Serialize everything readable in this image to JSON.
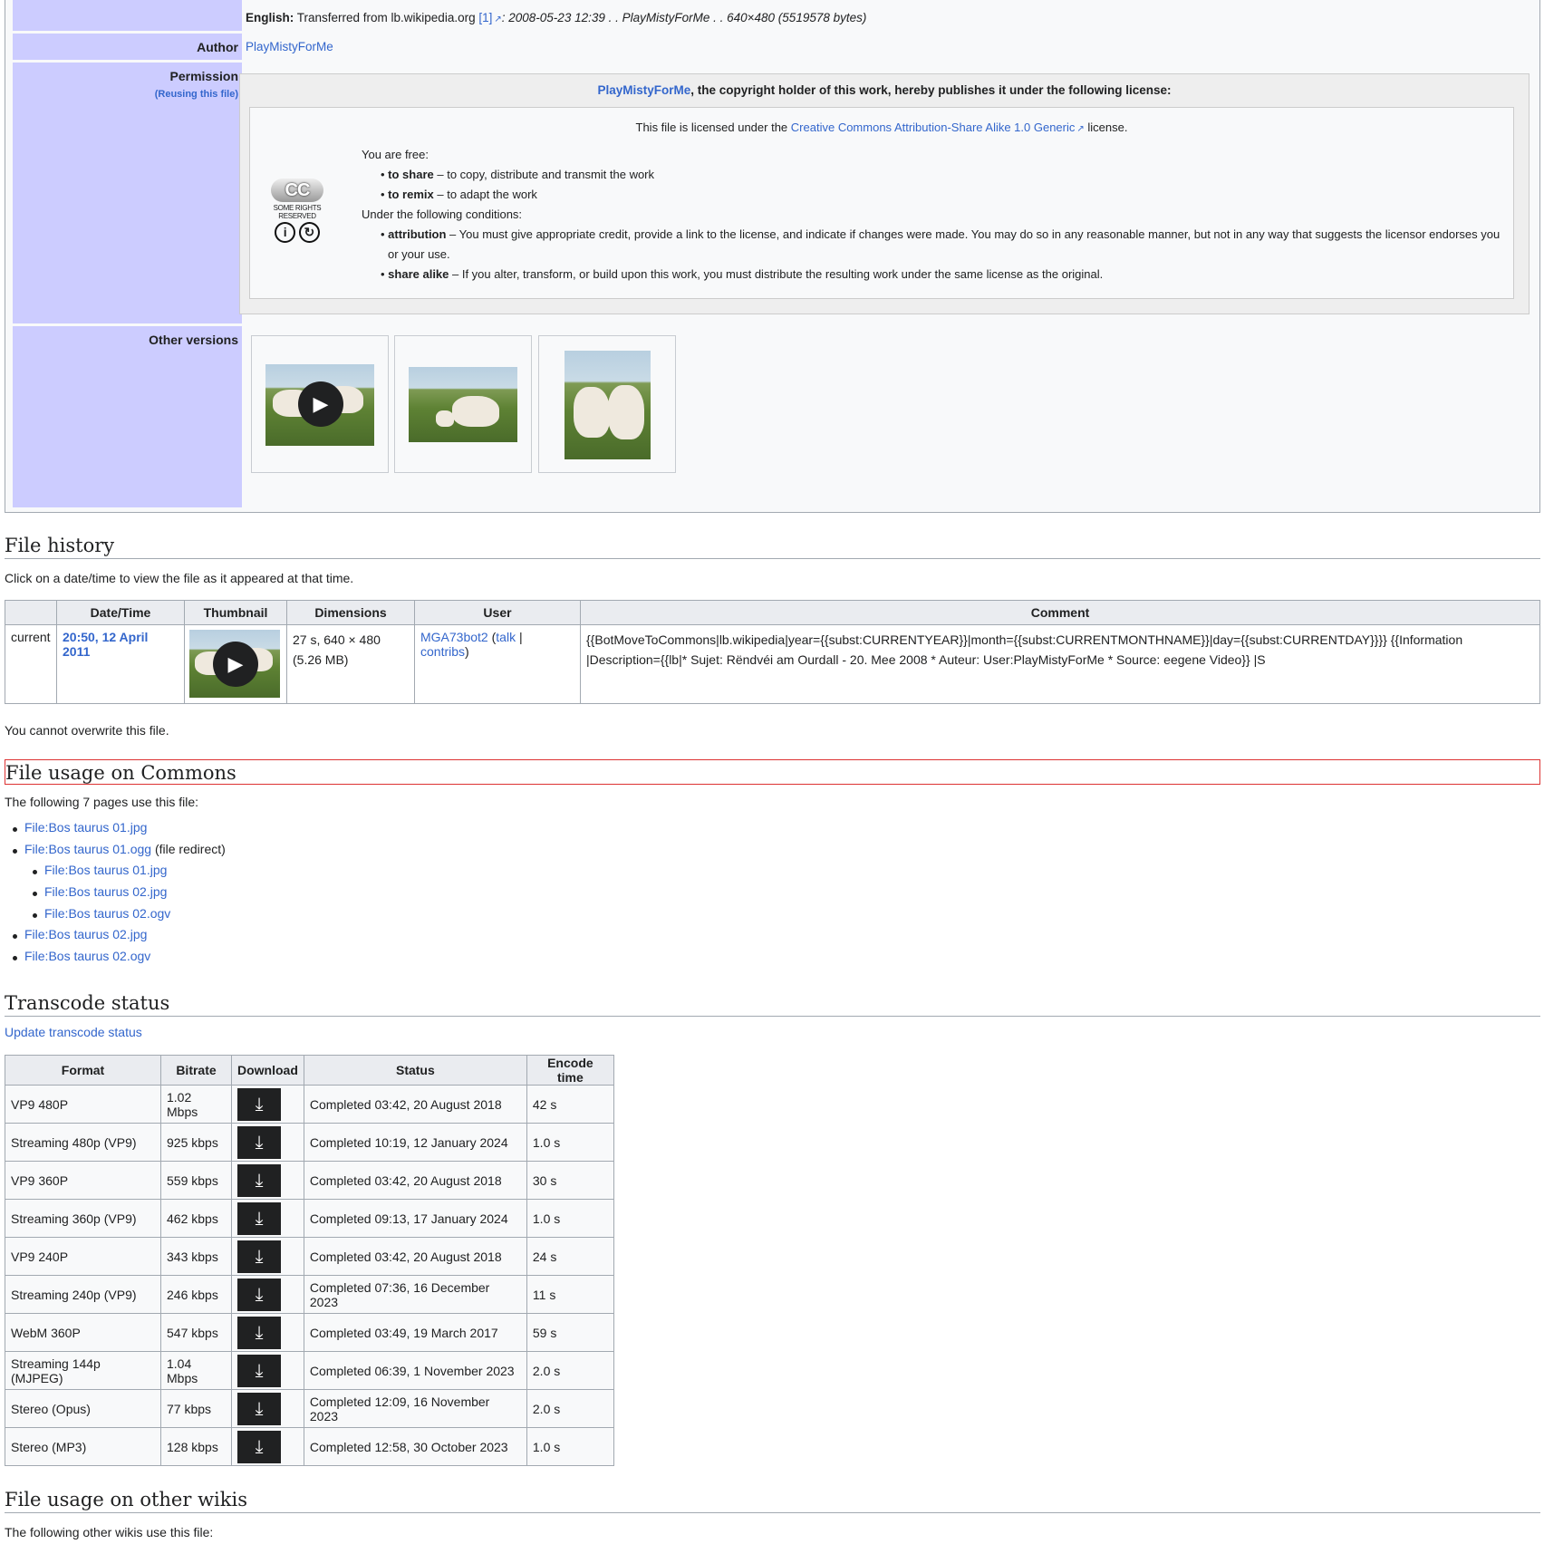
{
  "info": {
    "source_lang": "English:",
    "source_text": "Transferred from lb.wikipedia.org",
    "source_ref": "[1]",
    "source_log": ": 2008-05-23 12:39 . . PlayMistyForMe . . 640×480 (5519578 bytes)",
    "author_label": "Author",
    "author_value": "PlayMistyForMe",
    "permission_label": "Permission",
    "permission_reuse": "(Reusing this file)",
    "other_versions_label": "Other versions"
  },
  "license": {
    "holder": "PlayMistyForMe",
    "holder_suffix": ", the copyright holder of this work, hereby publishes it under the following license:",
    "licensed_prefix": "This file is licensed under the",
    "license_name": "Creative Commons Attribution-Share Alike 1.0 Generic",
    "licensed_suffix": "license.",
    "cc_badge": "CC",
    "cc_small": "SOME RIGHTS RESERVED",
    "free_heading": "You are free:",
    "share_term": "to share",
    "share_desc": " – to copy, distribute and transmit the work",
    "remix_term": "to remix",
    "remix_desc": " – to adapt the work",
    "conditions_heading": "Under the following conditions:",
    "attr_term": "attribution",
    "attr_desc": " – You must give appropriate credit, provide a link to the license, and indicate if changes were made. You may do so in any reasonable manner, but not in any way that suggests the licensor endorses you or your use.",
    "sa_term": "share alike",
    "sa_desc": " – If you alter, transform, or build upon this work, you must distribute the resulting work under the same license as the original."
  },
  "file_history": {
    "heading": "File history",
    "intro": "Click on a date/time to view the file as it appeared at that time.",
    "columns": [
      "",
      "Date/Time",
      "Thumbnail",
      "Dimensions",
      "User",
      "Comment"
    ],
    "row": {
      "status": "current",
      "datetime": "20:50, 12 April 2011",
      "dimensions_line1": "27 s, 640 × 480",
      "dimensions_line2": "(5.26 MB)",
      "user": "MGA73bot2",
      "talk": "talk",
      "contribs": "contribs",
      "comment": "{{BotMoveToCommons|lb.wikipedia|year={{subst:CURRENTYEAR}}|month={{subst:CURRENTMONTHNAME}}|day={{subst:CURRENTDAY}}}} {{Information |Description={{lb|* Sujet: Rëndvéi am Ourdall - 20. Mee 2008 * Auteur: User:PlayMistyForMe * Source: eegene Video}} |S"
    },
    "overwrite_note": "You cannot overwrite this file."
  },
  "usage": {
    "heading": "File usage on Commons",
    "intro": "The following 7 pages use this file:",
    "items": [
      {
        "label": "File:Bos taurus 01.jpg",
        "suffix": ""
      },
      {
        "label": "File:Bos taurus 01.ogg",
        "suffix": " (file redirect)"
      },
      {
        "label": "File:Bos taurus 01.jpg",
        "suffix": ""
      },
      {
        "label": "File:Bos taurus 02.jpg",
        "suffix": ""
      },
      {
        "label": "File:Bos taurus 02.ogv",
        "suffix": ""
      },
      {
        "label": "File:Bos taurus 02.jpg",
        "suffix": ""
      },
      {
        "label": "File:Bos taurus 02.ogv",
        "suffix": ""
      }
    ]
  },
  "transcode": {
    "heading": "Transcode status",
    "update_link": "Update transcode status",
    "columns": [
      "Format",
      "Bitrate",
      "Download",
      "Status",
      "Encode time"
    ],
    "rows": [
      {
        "format": "VP9 480P",
        "bitrate": "1.02 Mbps",
        "status": "Completed 03:42, 20 August 2018",
        "time": "42 s"
      },
      {
        "format": "Streaming 480p (VP9)",
        "bitrate": "925 kbps",
        "status": "Completed 10:19, 12 January 2024",
        "time": "1.0 s"
      },
      {
        "format": "VP9 360P",
        "bitrate": "559 kbps",
        "status": "Completed 03:42, 20 August 2018",
        "time": "30 s"
      },
      {
        "format": "Streaming 360p (VP9)",
        "bitrate": "462 kbps",
        "status": "Completed 09:13, 17 January 2024",
        "time": "1.0 s"
      },
      {
        "format": "VP9 240P",
        "bitrate": "343 kbps",
        "status": "Completed 03:42, 20 August 2018",
        "time": "24 s"
      },
      {
        "format": "Streaming 240p (VP9)",
        "bitrate": "246 kbps",
        "status": "Completed 07:36, 16 December 2023",
        "time": "11 s"
      },
      {
        "format": "WebM 360P",
        "bitrate": "547 kbps",
        "status": "Completed 03:49, 19 March 2017",
        "time": "59 s"
      },
      {
        "format": "Streaming 144p (MJPEG)",
        "bitrate": "1.04 Mbps",
        "status": "Completed 06:39, 1 November 2023",
        "time": "2.0 s"
      },
      {
        "format": "Stereo (Opus)",
        "bitrate": "77 kbps",
        "status": "Completed 12:09, 16 November 2023",
        "time": "2.0 s"
      },
      {
        "format": "Stereo (MP3)",
        "bitrate": "128 kbps",
        "status": "Completed 12:58, 30 October 2023",
        "time": "1.0 s"
      }
    ]
  },
  "other_wikis": {
    "heading": "File usage on other wikis",
    "intro": "The following other wikis use this file:"
  },
  "icons": {
    "play": "play-icon",
    "download": "download-icon",
    "external": "external-link-icon"
  },
  "colors": {
    "label_bg": "#ccccff",
    "link": "#3366cc",
    "highlight": "#d33"
  }
}
